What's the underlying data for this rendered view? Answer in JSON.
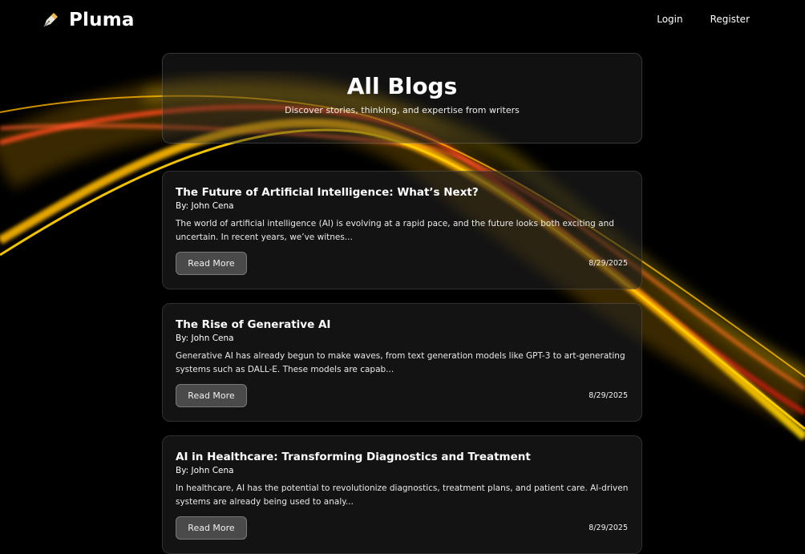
{
  "nav": {
    "brand": "Pluma",
    "brand_icon": "pen-nib-icon",
    "links": [
      "Login",
      "Register"
    ]
  },
  "hero": {
    "title": "All Blogs",
    "subtitle": "Discover stories, thinking, and expertise from writers"
  },
  "posts": [
    {
      "title": "The Future of Artificial Intelligence: What’s Next?",
      "author": "By: John Cena",
      "excerpt": "The world of artificial intelligence (AI) is evolving at a rapid pace, and the future looks both exciting and uncertain. In recent years, we’ve witnes...",
      "button": "Read More",
      "date": "8/29/2025"
    },
    {
      "title": "The Rise of Generative AI",
      "author": "By: John Cena",
      "excerpt": "Generative AI has already begun to make waves, from text generation models like GPT-3 to art-generating systems such as DALL-E. These models are capab...",
      "button": "Read More",
      "date": "8/29/2025"
    },
    {
      "title": "AI in Healthcare: Transforming Diagnostics and Treatment",
      "author": "By: John Cena",
      "excerpt": "In healthcare, AI has the potential to revolutionize diagnostics, treatment plans, and patient care. AI-driven systems are already being used to analy...",
      "button": "Read More",
      "date": "8/29/2025"
    }
  ],
  "theme": {
    "background": "#000000",
    "wave_colors": [
      "#ffd500",
      "#ff8a00",
      "#e52d1b"
    ]
  }
}
